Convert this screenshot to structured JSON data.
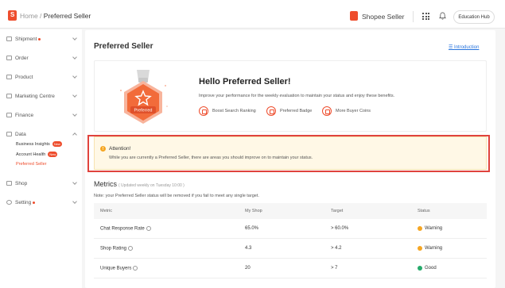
{
  "header": {
    "logo_glyph": "S",
    "breadcrumb_home": "Home",
    "breadcrumb_sep": " / ",
    "breadcrumb_current": "Preferred Seller",
    "shop_label": "Shopee Seller",
    "education_hub": "Education Hub",
    "brand_color": "#ee4d2d"
  },
  "sidebar": {
    "items": [
      {
        "label": "Shipment",
        "dot": true,
        "icon": "truck-icon"
      },
      {
        "label": "Order",
        "dot": false,
        "icon": "order-icon"
      },
      {
        "label": "Product",
        "dot": false,
        "icon": "box-icon"
      },
      {
        "label": "Marketing Centre",
        "dot": false,
        "icon": "tag-icon"
      },
      {
        "label": "Finance",
        "dot": false,
        "icon": "wallet-icon"
      },
      {
        "label": "Data",
        "dot": false,
        "icon": "chart-icon"
      },
      {
        "label": "Shop",
        "dot": false,
        "icon": "store-icon"
      },
      {
        "label": "Setting",
        "dot": true,
        "icon": "gear-icon"
      }
    ],
    "data_sub": [
      {
        "label": "Business Insights",
        "badge": "New"
      },
      {
        "label": "Account Health",
        "badge": "New"
      },
      {
        "label": "Preferred Seller",
        "badge": ""
      }
    ]
  },
  "main": {
    "title": "Preferred Seller",
    "intro_link": "Introduction",
    "hero": {
      "medal_label": "Preferred",
      "title": "Hello Preferred Seller!",
      "desc": "Improve your performance for the weekly evaluation to maintain your status and enjoy these benefits.",
      "benefits": [
        "Boost Search Ranking",
        "Preferred Badge",
        "More Buyer Coins"
      ]
    },
    "attention": {
      "icon": "!",
      "title": "Attention!",
      "text": "While you are currently a Preferred Seller, there are areas you should improve on to maintain your status."
    },
    "metrics": {
      "title": "Metrics",
      "updated": "( Updated weekly on Tuesday 10:00 )",
      "note": "Note: your Preferred Seller status will be removed if you fail to meet any single target.",
      "columns": [
        "Metric",
        "My Shop",
        "Target",
        "Status"
      ],
      "rows": [
        {
          "metric": "Chat Response Rate",
          "my_shop": "65.0%",
          "target": "> 60.0%",
          "status": "Warning",
          "status_color": "#f5a623"
        },
        {
          "metric": "Shop Rating",
          "my_shop": "4.3",
          "target": "> 4.2",
          "status": "Warning",
          "status_color": "#f5a623"
        },
        {
          "metric": "Unique Buyers",
          "my_shop": "20",
          "target": "> 7",
          "status": "Good",
          "status_color": "#26aa6b"
        }
      ]
    }
  }
}
